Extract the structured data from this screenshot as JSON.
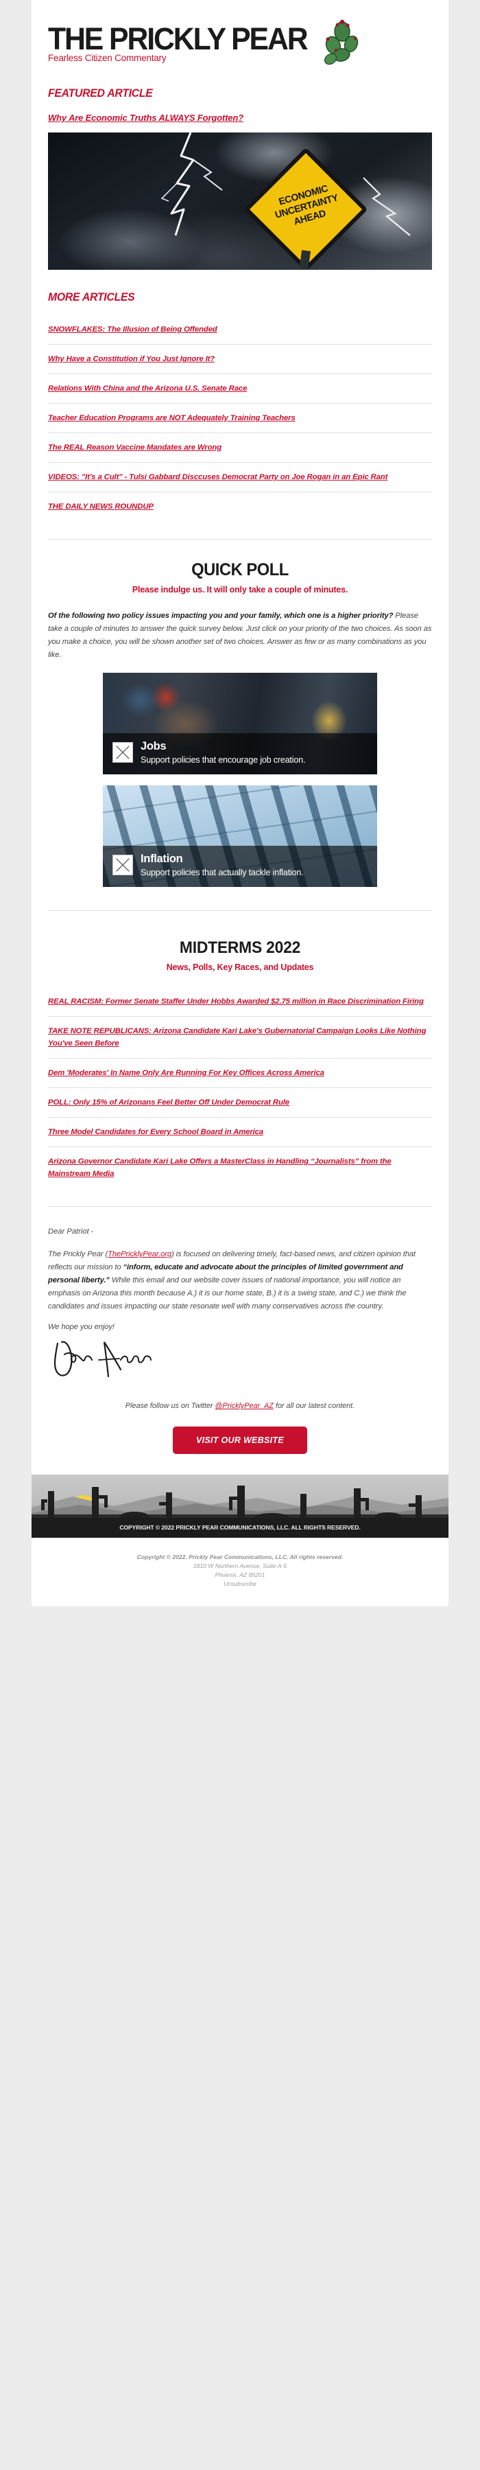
{
  "brand": {
    "title": "THE PRICKLY PEAR",
    "tagline": "Fearless Citizen Commentary",
    "accent": "#c8102e",
    "ink": "#1b1b1b"
  },
  "featured": {
    "heading": "FEATURED ARTICLE",
    "link": "Why Are Economic Truths ALWAYS Forgotten?",
    "image_alt": "storm-lightning-economic-uncertainty-sign",
    "sign_line1": "ECONOMIC",
    "sign_line2": "UNCERTAINTY",
    "sign_line3": "AHEAD"
  },
  "more_articles": {
    "heading": "MORE ARTICLES",
    "items": [
      "SNOWFLAKES: The Illusion of Being Offended",
      "Why Have a Constitution if You Just Ignore It?",
      "Relations With China and the Arizona U.S. Senate Race",
      "Teacher Education Programs are NOT Adequately Training Teachers",
      "The REAL Reason Vaccine Mandates are Wrong",
      "VIDEOS: \"It's a Cult\" - Tulsi Gabbard Disccuses Democrat Party on Joe Rogan in an Epic Rant",
      "THE DAILY NEWS ROUNDUP"
    ]
  },
  "poll": {
    "title": "QUICK POLL",
    "subtitle": "Please indulge us. It will only take a couple of minutes.",
    "intro_bold": "Of the following two policy issues impacting you and your family, which one is a higher priority?",
    "intro_rest": " Please take a couple of minutes to answer the quick survey below. Just click on your priority of the two choices. As soon as you make a choice, you will be shown another set of two choices. Answer as few or as many combinations as you like.",
    "options": [
      {
        "title": "Jobs",
        "description": "Support policies that encourage job creation.",
        "image_alt": "mechanic-working-photo"
      },
      {
        "title": "Inflation",
        "description": "Support policies that actually tackle inflation.",
        "image_alt": "inflation-chart-photo"
      }
    ]
  },
  "midterms": {
    "title": "MIDTERMS  2022",
    "subtitle": "News, Polls, Key Races, and Updates",
    "items": [
      "REAL RACISM: Former Senate Staffer Under Hobbs Awarded $2.75 million in Race Discrimination Firing",
      "TAKE NOTE REPUBLICANS: Arizona Candidate Kari Lake's Gubernatorial Campaign Looks Like Nothing You've Seen Before",
      "Dem 'Moderates' In Name Only Are Running For Key Offices Across America",
      "POLL: Only 15% of Arizonans Feel Better Off Under Democrat Rule",
      "Three Model Candidates for Every School Board in America",
      "Arizona Governor Candidate Kari Lake Offers a MasterClass in Handling “Journalists” from the Mainstream Media"
    ]
  },
  "letter": {
    "salutation": "Dear Patriot  -",
    "p1_a": "The Prickly Pear (",
    "p1_link": "ThePricklyPear.org",
    "p1_b": ") is focused on delivering timely, fact-based news, and citizen opinion that reflects our mission to ",
    "p1_bold": "“inform, educate and advocate about the principles of limited government and personal liberty.”",
    "p1_c": " While this email and our website cover issues of national importance, you will notice an emphasis on Arizona this month because A.) it is our home state, B.) it is a swing state, and C.) we think the candidates and issues impacting our state resonate well with many conservatives across the country.",
    "closing": "We hope you enjoy!",
    "signature_name": "John Annon",
    "follow_a": "Please follow us on Twitter ",
    "follow_handle": "@PricklyPear_AZ",
    "follow_b": " for all our latest content."
  },
  "cta": {
    "label": "VISIT OUR WEBSITE"
  },
  "footer": {
    "banner_copyright": "COPYRIGHT © 2022 PRICKLY PEAR COMMUNICATIONS, LLC. ALL RIGHTS RESERVED.",
    "legal_line1": "Copyright © 2022. Prickly Pear Communications, LLC. All rights reserved.",
    "legal_line2": "1810 W Northern Avenue, Suite A-5",
    "legal_line3": "Phoenix, AZ 85201",
    "unsubscribe": "Unsubscribe"
  }
}
